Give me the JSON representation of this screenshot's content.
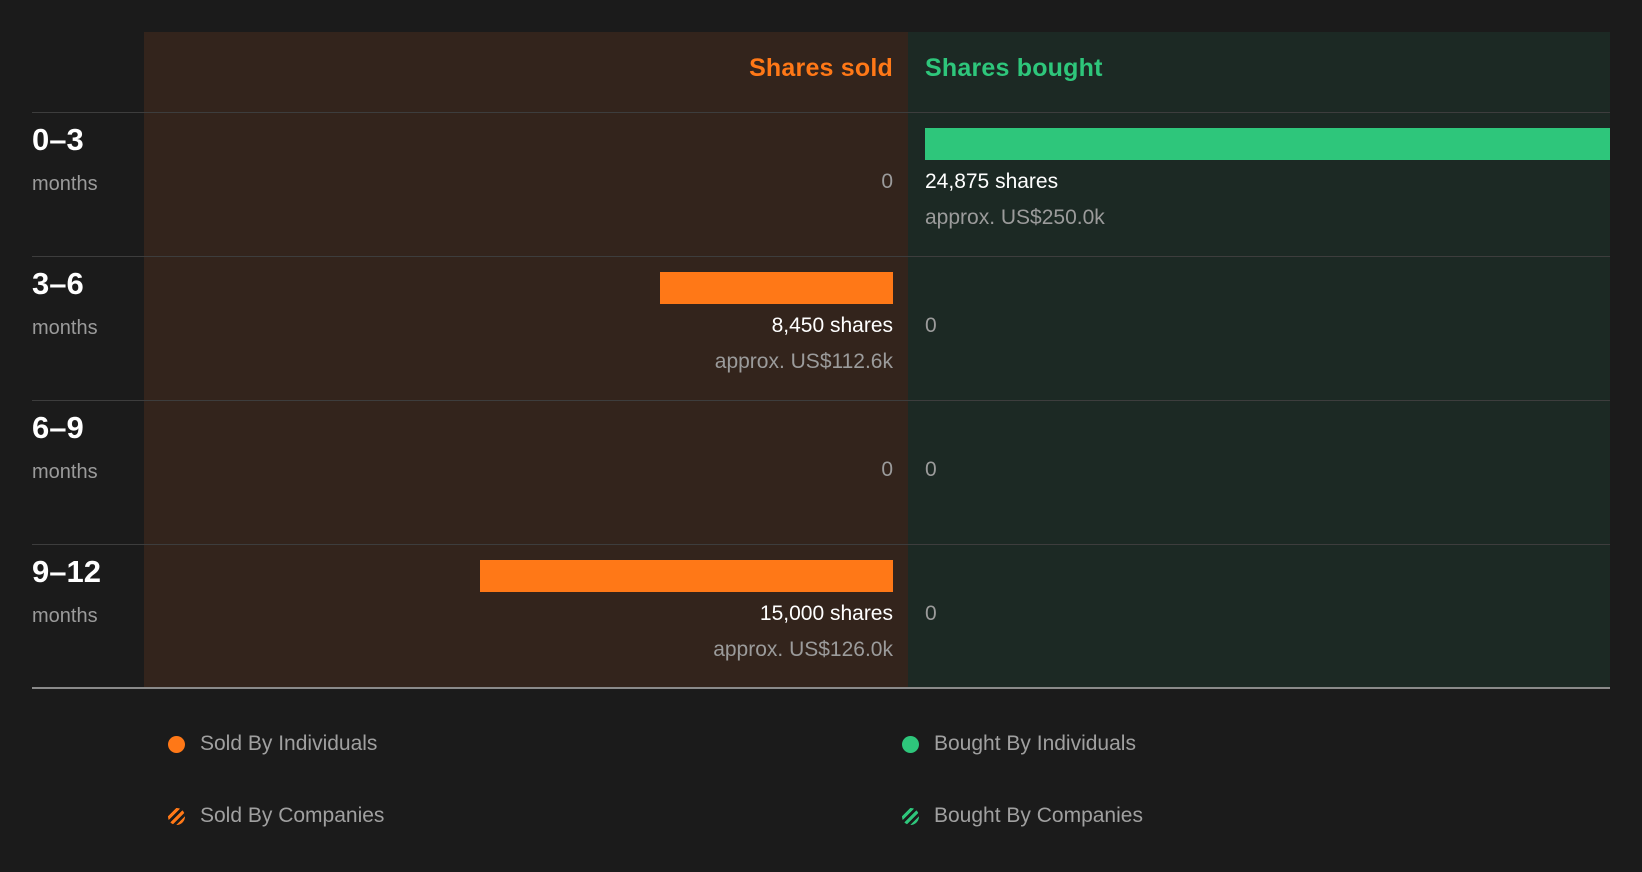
{
  "chart_data": {
    "type": "bar",
    "headers": {
      "sold": "Shares sold",
      "bought": "Shares bought"
    },
    "categories": [
      {
        "period": "0–3",
        "unit": "months"
      },
      {
        "period": "3–6",
        "unit": "months"
      },
      {
        "period": "6–9",
        "unit": "months"
      },
      {
        "period": "9–12",
        "unit": "months"
      }
    ],
    "series": [
      {
        "name": "Shares sold",
        "values": [
          0,
          8450,
          0,
          15000
        ]
      },
      {
        "name": "Shares bought",
        "values": [
          24875,
          0,
          0,
          0
        ]
      }
    ],
    "labels": {
      "sold": [
        {
          "shares": "0",
          "approx": ""
        },
        {
          "shares": "8,450 shares",
          "approx": "approx. US$112.6k"
        },
        {
          "shares": "0",
          "approx": ""
        },
        {
          "shares": "15,000 shares",
          "approx": "approx. US$126.0k"
        }
      ],
      "bought": [
        {
          "shares": "24,875 shares",
          "approx": "approx. US$250.0k"
        },
        {
          "shares": "0",
          "approx": ""
        },
        {
          "shares": "0",
          "approx": ""
        },
        {
          "shares": "0",
          "approx": ""
        }
      ]
    },
    "legend": [
      {
        "label": "Sold By Individuals",
        "style": "solid",
        "color": "#ff7817"
      },
      {
        "label": "Bought By Individuals",
        "style": "solid",
        "color": "#2ec67b"
      },
      {
        "label": "Sold By Companies",
        "style": "striped",
        "color": "#ff7817"
      },
      {
        "label": "Bought By Companies",
        "style": "striped",
        "color": "#2ec67b"
      }
    ],
    "colors": {
      "sold": "#ff7817",
      "bought": "#2ec67b",
      "sold_panel": "#33241c",
      "bought_panel": "#1c2924"
    }
  }
}
